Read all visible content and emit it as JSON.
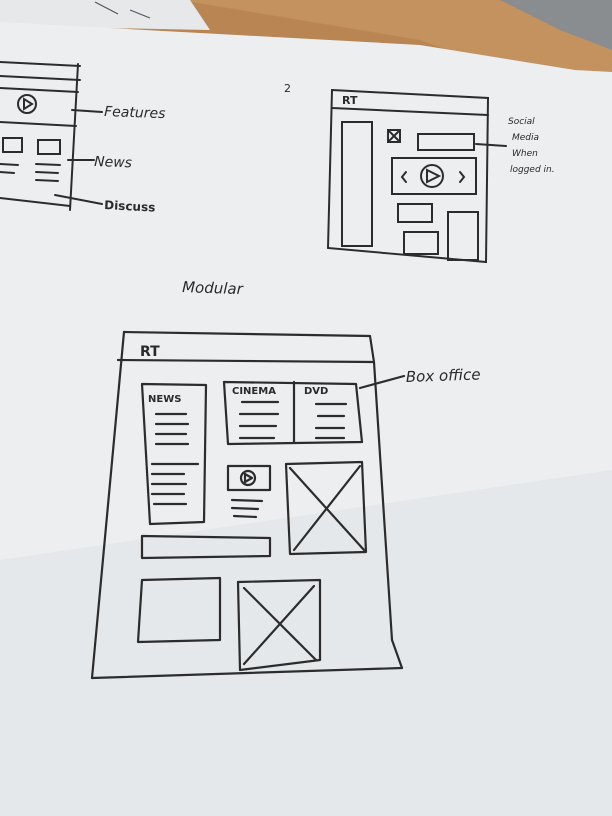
{
  "colors": {
    "table": "#b98553",
    "paper": "#eceef0",
    "pencil": "#2c2c2c"
  },
  "sketch1": {
    "labels": {
      "features": "Features",
      "news": "News",
      "discuss": "Discuss"
    }
  },
  "sketch2": {
    "number": "2",
    "logo": "RT",
    "note_line1": "Social",
    "note_line2": "Media",
    "note_line3": "When",
    "note_line4": "logged in."
  },
  "sketch3": {
    "heading": "Modular",
    "logo": "RT",
    "news_label": "NEWS",
    "cinema_label": "CINEMA",
    "dvd_label": "DVD",
    "box_office_label": "Box office"
  }
}
